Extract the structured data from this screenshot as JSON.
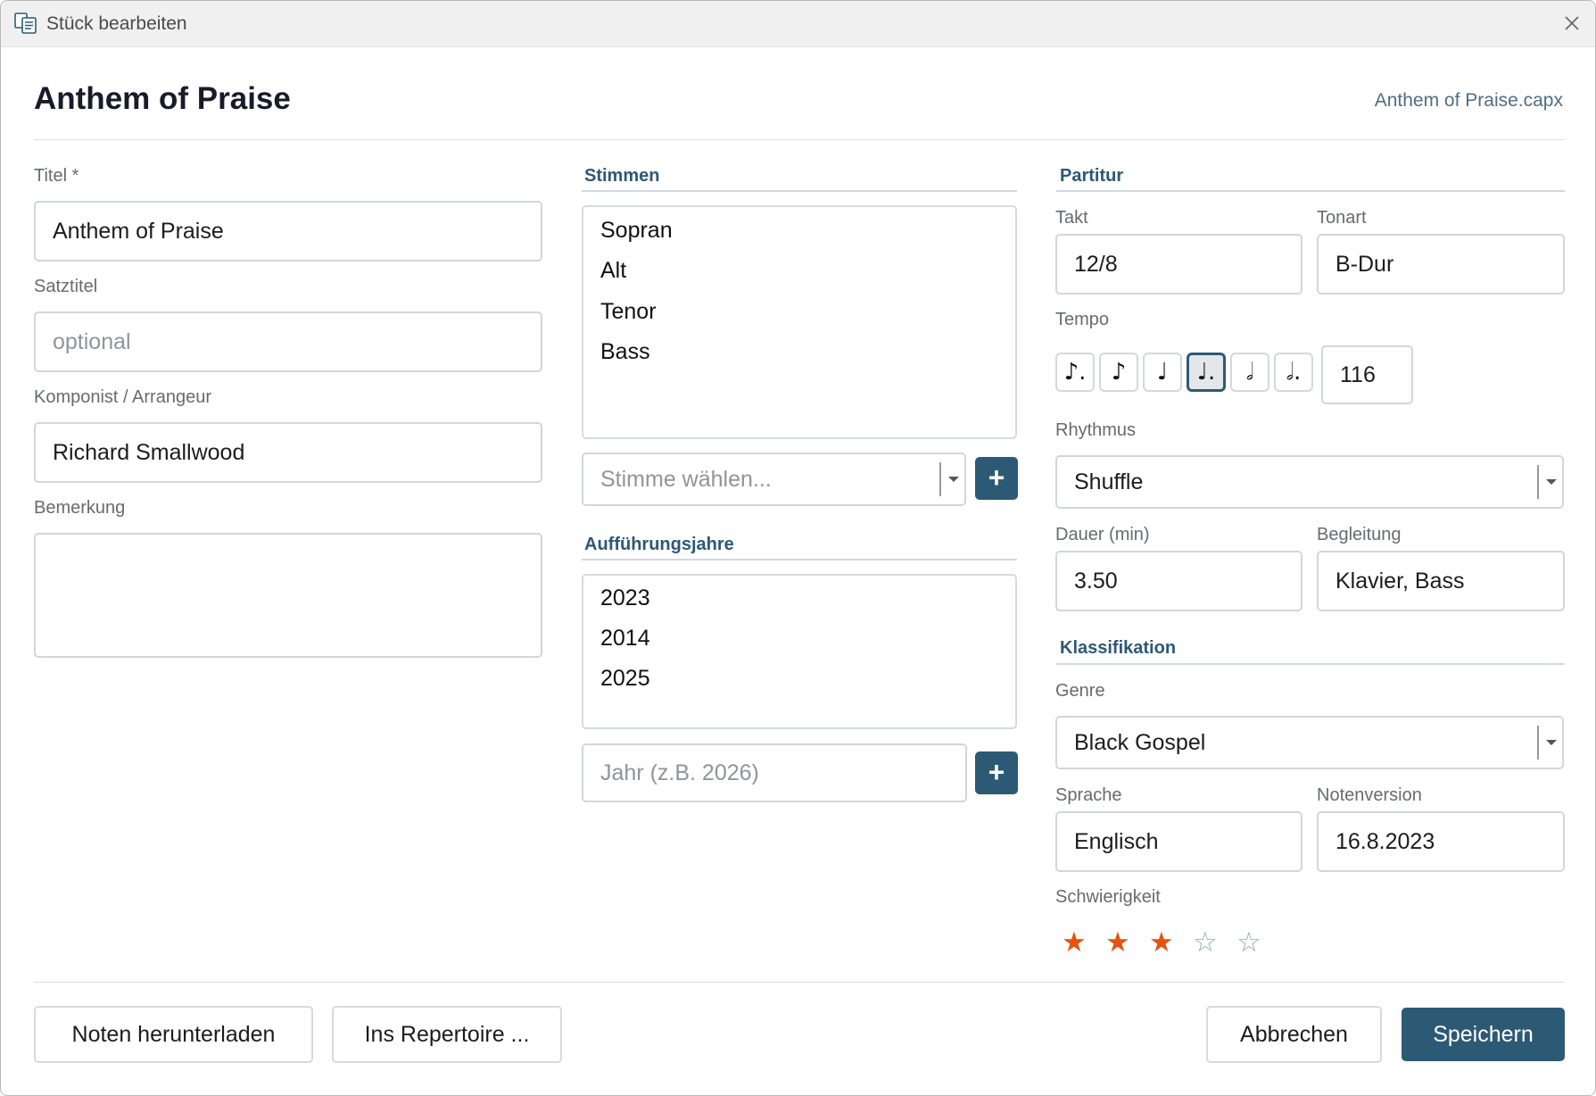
{
  "window": {
    "title": "Stück bearbeiten"
  },
  "header": {
    "title": "Anthem of Praise",
    "file_name": "Anthem of Praise.capx"
  },
  "left": {
    "titel_label": "Titel *",
    "titel_value": "Anthem of Praise",
    "satztitel_label": "Satztitel",
    "satztitel_placeholder": "optional",
    "komponist_label": "Komponist / Arrangeur",
    "komponist_value": "Richard Smallwood",
    "bemerkung_label": "Bemerkung",
    "bemerkung_value": ""
  },
  "stimmen": {
    "heading": "Stimmen",
    "items": [
      "Sopran",
      "Alt",
      "Tenor",
      "Bass"
    ],
    "select_placeholder": "Stimme wählen...",
    "add_label": "+"
  },
  "jahre": {
    "heading": "Aufführungsjahre",
    "items": [
      "2023",
      "2014",
      "2025"
    ],
    "input_placeholder": "Jahr (z.B. 2026)",
    "add_label": "+"
  },
  "partitur": {
    "heading": "Partitur",
    "takt_label": "Takt",
    "takt_value": "12/8",
    "tonart_label": "Tonart",
    "tonart_value": "B-Dur",
    "tempo_label": "Tempo",
    "tempo_notes": [
      {
        "icon": "dotted-eighth-note-icon",
        "glyph": "♪."
      },
      {
        "icon": "eighth-note-icon",
        "glyph": "♪"
      },
      {
        "icon": "quarter-note-icon",
        "glyph": "♩"
      },
      {
        "icon": "dotted-quarter-note-icon",
        "glyph": "♩.",
        "selected": true
      },
      {
        "icon": "half-note-icon",
        "glyph": "𝅗𝅥"
      },
      {
        "icon": "dotted-half-note-icon",
        "glyph": "𝅗𝅥."
      }
    ],
    "tempo_value": "116",
    "rhythmus_label": "Rhythmus",
    "rhythmus_value": "Shuffle",
    "dauer_label": "Dauer (min)",
    "dauer_value": "3.50",
    "begleitung_label": "Begleitung",
    "begleitung_value": "Klavier, Bass"
  },
  "klassifikation": {
    "heading": "Klassifikation",
    "genre_label": "Genre",
    "genre_value": "Black Gospel",
    "sprache_label": "Sprache",
    "sprache_value": "Englisch",
    "notenversion_label": "Notenversion",
    "notenversion_value": "16.8.2023",
    "schwierigkeit_label": "Schwierigkeit",
    "schwierigkeit_rating": 3,
    "schwierigkeit_max": 5,
    "star_filled": "★",
    "star_empty": "☆"
  },
  "footer": {
    "download_label": "Noten herunterladen",
    "repertoire_label": "Ins Repertoire ...",
    "cancel_label": "Abbrechen",
    "save_label": "Speichern"
  },
  "colors": {
    "accent": "#2c5a75",
    "section_heading": "#2d5876",
    "star_on": "#e25410",
    "star_off": "#8faabe"
  }
}
